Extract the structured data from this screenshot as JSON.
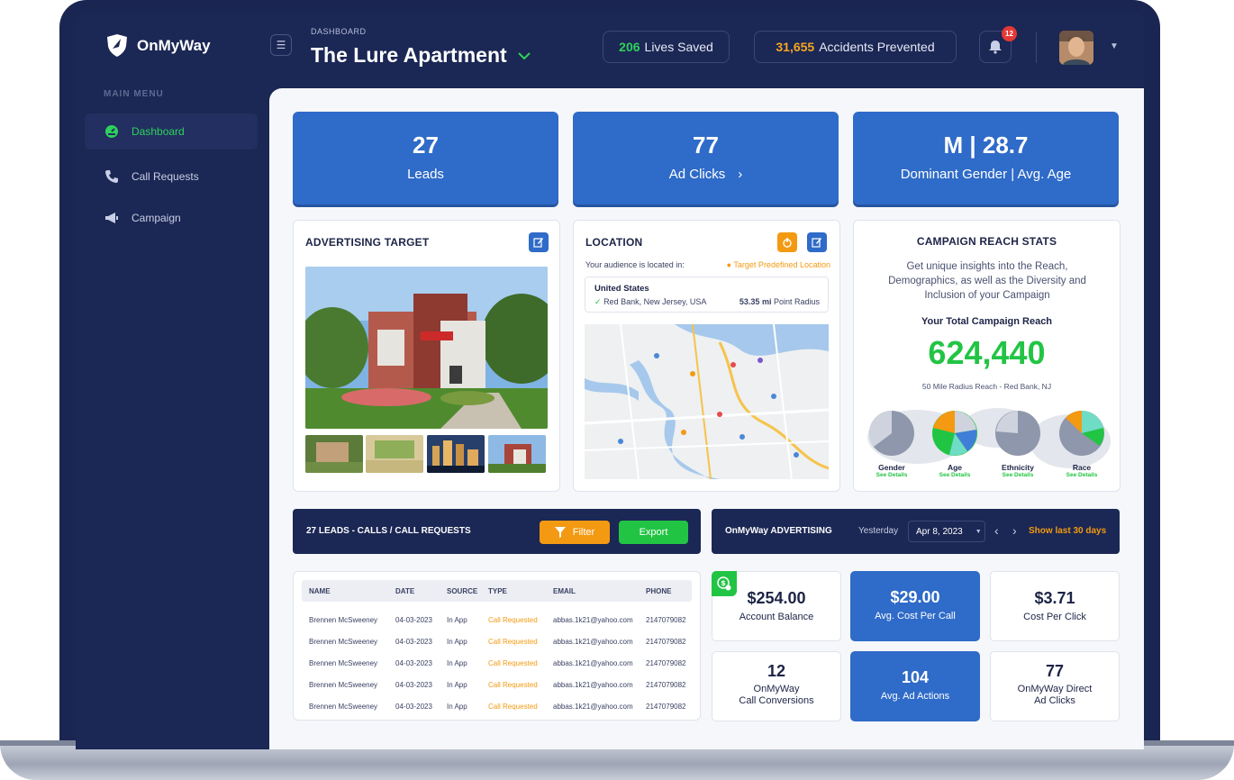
{
  "app": {
    "name": "OnMyWay"
  },
  "sidebar": {
    "heading": "MAIN MENU",
    "items": [
      {
        "label": "Dashboard",
        "icon": "dashboard-gauge-icon",
        "active": true
      },
      {
        "label": "Call Requests",
        "icon": "phone-icon",
        "active": false
      },
      {
        "label": "Campaign",
        "icon": "megaphone-icon",
        "active": false
      }
    ]
  },
  "header": {
    "breadcrumb": "DASHBOARD",
    "title": "The Lure Apartment",
    "lives_saved_value": "206",
    "lives_saved_label": "Lives Saved",
    "accidents_value": "31,655",
    "accidents_label": "Accidents Prevented",
    "notification_count": "12"
  },
  "kpis": [
    {
      "value": "27",
      "label": "Leads"
    },
    {
      "value": "77",
      "label": "Ad Clicks"
    },
    {
      "value": "M | 28.7",
      "label": "Dominant Gender | Avg. Age"
    }
  ],
  "advertising_target": {
    "title": "ADVERTISING TARGET"
  },
  "location": {
    "title": "LOCATION",
    "subtitle": "Your audience is located in:",
    "link": "Target Predefined Location",
    "country": "United States",
    "city": "Red Bank, New Jersey, USA",
    "radius_value": "53.35",
    "radius_unit": "mi",
    "radius_label": "Point Radius"
  },
  "campaign_reach": {
    "title": "CAMPAIGN REACH STATS",
    "description": "Get unique insights into the Reach, Demographics, as well as the Diversity and Inclusion of your Campaign",
    "total_label": "Your Total Campaign Reach",
    "total_value": "624,440",
    "radius_note": "50 Mile Radius Reach - Red Bank, NJ",
    "see_details": "See Details",
    "pies": [
      {
        "label": "Gender"
      },
      {
        "label": "Age"
      },
      {
        "label": "Ethnicity"
      },
      {
        "label": "Race"
      }
    ]
  },
  "leads": {
    "title": "27 LEADS - CALLS / CALL REQUESTS",
    "filter_label": "Filter",
    "export_label": "Export",
    "columns": [
      "NAME",
      "DATE",
      "SOURCE",
      "TYPE",
      "EMAIL",
      "PHONE"
    ],
    "rows": [
      [
        "Brennen McSweeney",
        "04-03-2023",
        "In App",
        "Call Requested",
        "abbas.1k21@yahoo.com",
        "2147079082"
      ],
      [
        "Brennen McSweeney",
        "04-03-2023",
        "In App",
        "Call Requested",
        "abbas.1k21@yahoo.com",
        "2147079082"
      ],
      [
        "Brennen McSweeney",
        "04-03-2023",
        "In App",
        "Call Requested",
        "abbas.1k21@yahoo.com",
        "2147079082"
      ],
      [
        "Brennen McSweeney",
        "04-03-2023",
        "In App",
        "Call Requested",
        "abbas.1k21@yahoo.com",
        "2147079082"
      ],
      [
        "Brennen McSweeney",
        "04-03-2023",
        "In App",
        "Call Requested",
        "abbas.1k21@yahoo.com",
        "2147079082"
      ]
    ]
  },
  "advertising": {
    "title": "OnMyWay ADVERTISING",
    "period_label": "Yesterday",
    "date_value": "Apr 8, 2023",
    "show_last": "Show last 30 days",
    "metrics": [
      {
        "value": "$254.00",
        "label": "Account Balance",
        "style": "white"
      },
      {
        "value": "$29.00",
        "label": "Avg. Cost Per Call",
        "style": "blue"
      },
      {
        "value": "$3.71",
        "label": "Cost Per Click",
        "style": "white"
      },
      {
        "value": "12",
        "label": "OnMyWay\nCall Conversions",
        "style": "white"
      },
      {
        "value": "104",
        "label": "Avg. Ad Actions",
        "style": "blue"
      },
      {
        "value": "77",
        "label": "OnMyWay Direct\nAd Clicks",
        "style": "white"
      }
    ]
  },
  "colors": {
    "navy": "#1b2754",
    "brand_blue": "#2f6bc8",
    "green": "#22c444",
    "orange": "#f39a12"
  }
}
